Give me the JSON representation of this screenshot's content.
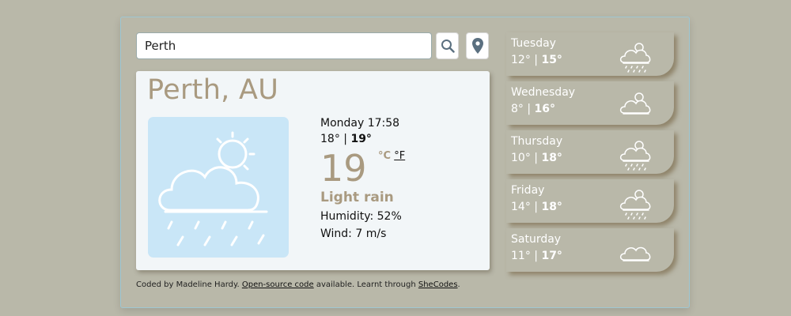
{
  "search": {
    "value": "Perth"
  },
  "current": {
    "city": "Perth, AU",
    "datetime": "Monday 17:58",
    "temp_low": "18°",
    "separator": " | ",
    "temp_high": "19°",
    "temperature": "19",
    "unit_c": "°C",
    "unit_f": "°F",
    "condition": "Light rain",
    "humidity": "Humidity: 52%",
    "wind": "Wind: 7 m/s",
    "icon": "cloud-rain-sun-icon"
  },
  "forecast": [
    {
      "day": "Tuesday",
      "low": "12°",
      "high": "15°",
      "icon": "rain-icon"
    },
    {
      "day": "Wednesday",
      "low": "8°",
      "high": "16°",
      "icon": "partly-cloudy-icon"
    },
    {
      "day": "Thursday",
      "low": "10°",
      "high": "18°",
      "icon": "rain-icon"
    },
    {
      "day": "Friday",
      "low": "14°",
      "high": "18°",
      "icon": "rain-icon"
    },
    {
      "day": "Saturday",
      "low": "11°",
      "high": "17°",
      "icon": "cloud-icon"
    }
  ],
  "footer": {
    "prefix": "Coded by Madeline Hardy. ",
    "link1": "Open-source code",
    "middle": " available. Learnt through ",
    "link2": "SheCodes",
    "suffix": "."
  },
  "colors": {
    "background": "#b9b8a9",
    "accent": "#a99a80",
    "card": "#f2f6f8",
    "icon_bg": "#c9e6f7"
  }
}
